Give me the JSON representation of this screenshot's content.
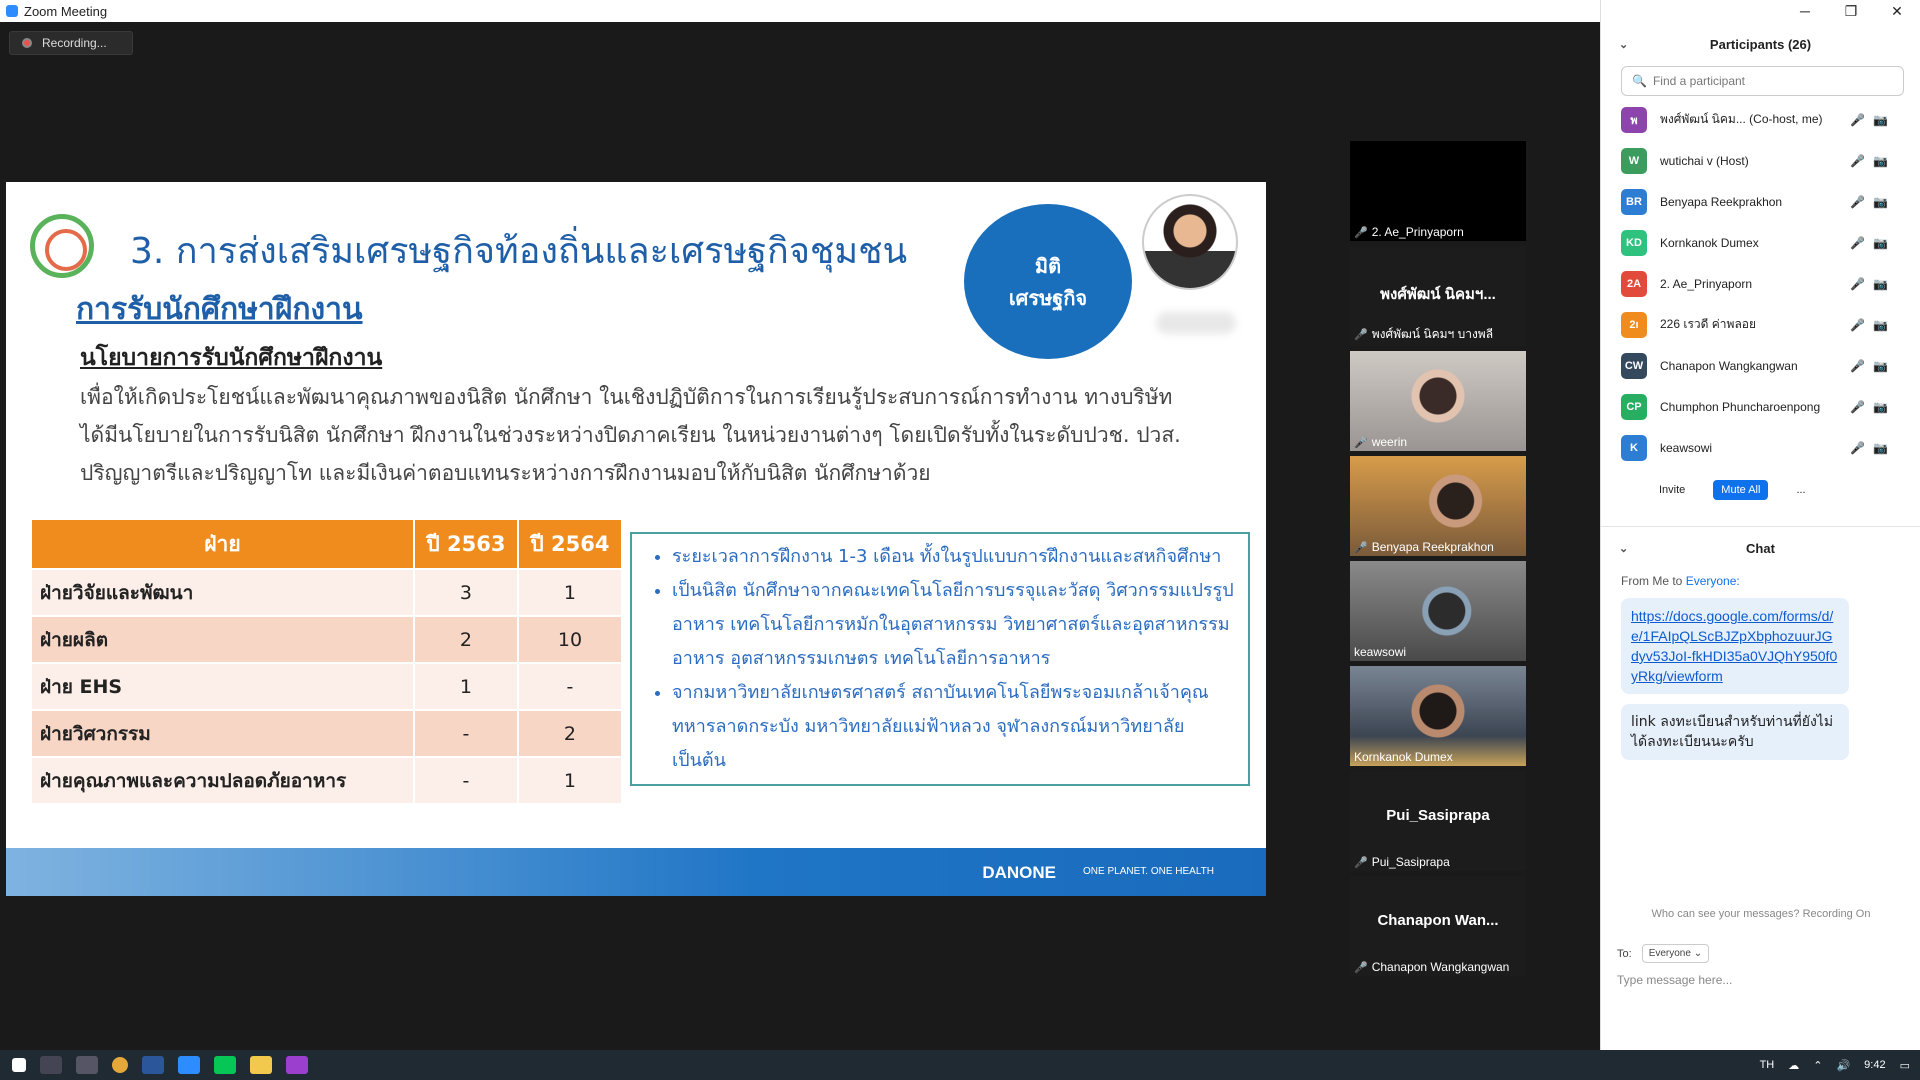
{
  "window": {
    "title": "Zoom Meeting",
    "minimize": "─",
    "restore": "❐",
    "close": "✕"
  },
  "recording": "Recording...",
  "slide": {
    "title": "3. การส่งเสริมเศรษฐกิจท้องถิ่นและเศรษฐกิจชุมชน",
    "subtitle": "การรับนักศึกษาฝึกงาน",
    "section": "นโยบายการรับนักศึกษาฝึกงาน",
    "paragraph": "เพื่อให้เกิดประโยชน์และพัฒนาคุณภาพของนิสิต นักศึกษา ในเชิงปฏิบัติการในการเรียนรู้ประสบการณ์การทำงาน ทางบริษัทได้มีนโยบายในการรับนิสิต นักศึกษา ฝึกงานในช่วงระหว่างปิดภาคเรียน ในหน่วยงานต่างๆ โดยเปิดรับทั้งในระดับปวช. ปวส. ปริญญาตรีและปริญญาโท และมีเงินค่าตอบแทนระหว่างการฝึกงานมอบให้กับนิสิต นักศึกษาด้วย",
    "bubble": "มิติ\nเศรษฐกิจ",
    "table": {
      "headers": [
        "ฝ่าย",
        "ปี 2563",
        "ปี 2564"
      ],
      "rows": [
        [
          "ฝ่ายวิจัยและพัฒนา",
          "3",
          "1"
        ],
        [
          "ฝ่ายผลิต",
          "2",
          "10"
        ],
        [
          "ฝ่าย EHS",
          "1",
          "-"
        ],
        [
          "ฝ่ายวิศวกรรม",
          "-",
          "2"
        ],
        [
          "ฝ่ายคุณภาพและความปลอดภัยอาหาร",
          "-",
          "1"
        ]
      ]
    },
    "notes": [
      "ระยะเวลาการฝึกงาน 1-3 เดือน ทั้งในรูปแบบการฝึกงานและสหกิจศึกษา",
      "เป็นนิสิต นักศึกษาจากคณะเทคโนโลยีการบรรจุและวัสดุ วิศวกรรมแปรรูปอาหาร เทคโนโลยีการหมักในอุตสาหกรรม วิทยาศาสตร์และอุตสาหกรรมอาหาร อุตสาหกรรมเกษตร เทคโนโลยีการอาหาร",
      "จากมหาวิทยาลัยเกษตรศาสตร์ สถาบันเทคโนโลยีพระจอมเกล้าเจ้าคุณทหารลาดกระบัง มหาวิทยาลัยแม่ฟ้าหลวง จุฬาลงกรณ์มหาวิทยาลัย เป็นต้น"
    ],
    "footer_brand": "DANONE",
    "footer_tag": "ONE PLANET. ONE HEALTH"
  },
  "tiles": [
    {
      "name": "2. Ae_Prinyaporn",
      "big": "",
      "bg": "#000000"
    },
    {
      "name": "พงศ์พัฒน์ นิคมฯ บางพลี",
      "big": "พงศ์พัฒน์ นิคมฯ...",
      "bg": "#1c1c1c"
    },
    {
      "name": "weerin",
      "big": "",
      "bg": "#b9b3ae"
    },
    {
      "name": "Benyapa Reekprakhon",
      "big": "",
      "bg": "#c88a3c"
    },
    {
      "name": "keawsowi",
      "big": "",
      "bg": "#6f6f6f"
    },
    {
      "name": "Kornkanok Dumex",
      "big": "",
      "bg": "#5a6677"
    },
    {
      "name": "Pui_Sasiprapa",
      "big": "Pui_Sasiprapa",
      "bg": "#1c1c1c"
    },
    {
      "name": "Chanapon Wangkangwan",
      "big": "Chanapon  Wan...",
      "bg": "#1c1c1c"
    }
  ],
  "participants": {
    "header": "Participants (26)",
    "search_placeholder": "Find a participant",
    "list": [
      {
        "initials": "พ",
        "name": "พงศ์พัฒน์ นิคม...  (Co-host, me)",
        "color": "#8e44ad"
      },
      {
        "initials": "W",
        "name": "wutichai v (Host)",
        "color": "#3a9d5d"
      },
      {
        "initials": "BR",
        "name": "Benyapa Reekprakhon",
        "color": "#2d7dd2"
      },
      {
        "initials": "KD",
        "name": "Kornkanok Dumex",
        "color": "#2ec27e"
      },
      {
        "initials": "2A",
        "name": "2. Ae_Prinyaporn",
        "color": "#e24b3b"
      },
      {
        "initials": "2ı",
        "name": "226 เรวดี ค่าพลอย",
        "color": "#f08c1e"
      },
      {
        "initials": "CW",
        "name": "Chanapon Wangkangwan",
        "color": "#34495e"
      },
      {
        "initials": "CP",
        "name": "Chumphon Phuncharoenpong",
        "color": "#27ae60"
      },
      {
        "initials": "K",
        "name": "keawsowi",
        "color": "#2d7dd2"
      }
    ],
    "invite": "Invite",
    "mute_all": "Mute All",
    "more": "..."
  },
  "chat": {
    "header": "Chat",
    "from": "From Me to",
    "to_who": "Everyone:",
    "link": "https://docs.google.com/forms/d/e/1FAIpQLScBJZpXbphozuurJGdyv53JoI-fkHDI35a0VJQhY950f0yRkg/viewform",
    "message": "link ลงทะเบียนสำหรับท่านที่ยังไม่ได้ลงทะเบียนนะครับ",
    "visibility": "Who can see your messages? Recording On",
    "to_label": "To:",
    "to_value": "Everyone ⌄",
    "placeholder": "Type message here..."
  },
  "taskbar": {
    "lang": "TH",
    "time": "9:42"
  }
}
